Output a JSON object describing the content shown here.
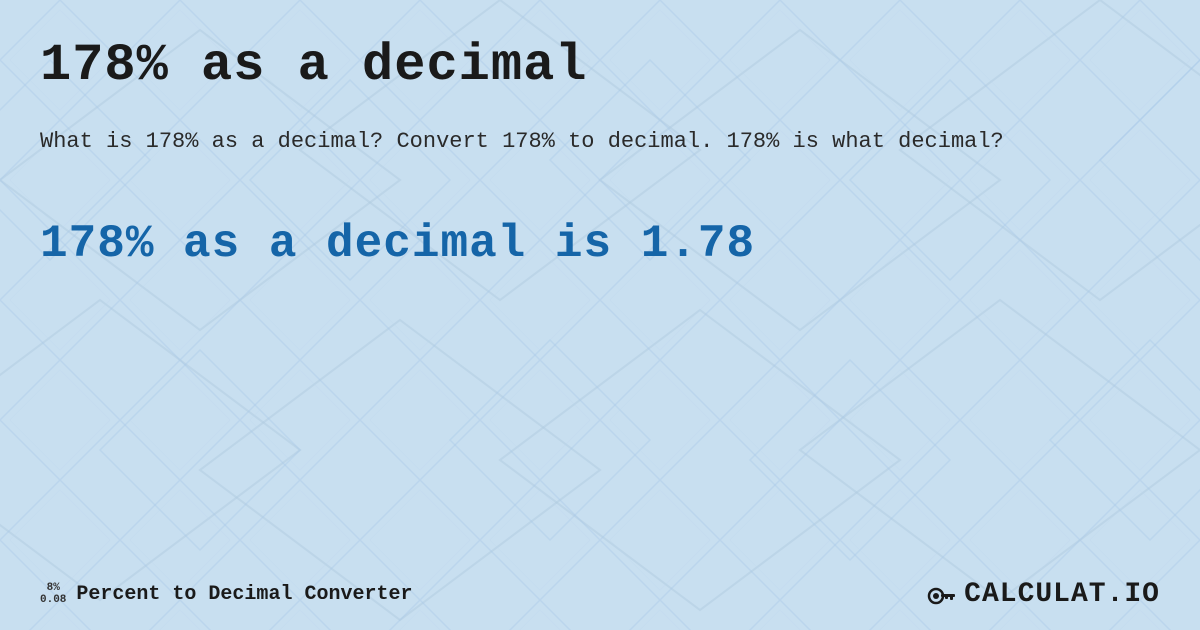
{
  "page": {
    "title": "178% as a decimal",
    "description": "What is 178% as a decimal? Convert 178% to decimal. 178% is what decimal?",
    "result": "178% as a decimal is 1.78",
    "footer": {
      "icon_top": "8%",
      "icon_bottom": "0.08",
      "label": "Percent to Decimal Converter",
      "logo_text": "CALCULAT.IO"
    }
  }
}
